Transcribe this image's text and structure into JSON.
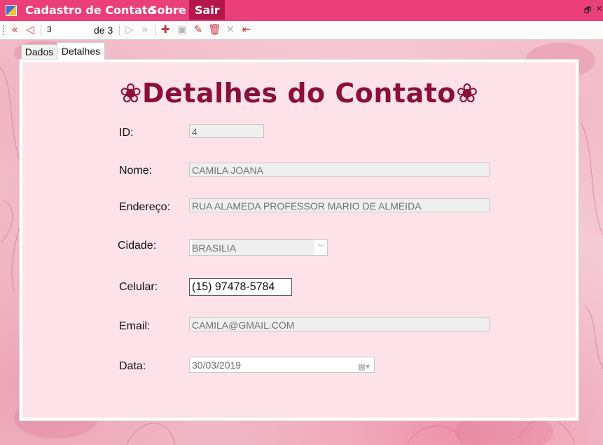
{
  "menu": {
    "items": [
      "Cadastro de Contato",
      "Sobre",
      "Sair"
    ]
  },
  "window": {
    "restore": "🗗",
    "close": "✕"
  },
  "toolbar": {
    "position": "3",
    "total": "de 3"
  },
  "tabs": [
    "Dados",
    "Detalhes"
  ],
  "form": {
    "title": "❀Detalhes do Contato❀",
    "id": {
      "label": "ID:",
      "value": "4"
    },
    "nome": {
      "label": "Nome:",
      "value": "CAMILA JOANA"
    },
    "endereco": {
      "label": "Endereço:",
      "value": "RUA ALAMEDA PROFESSOR MARIO DE ALMEIDA"
    },
    "cidade": {
      "label": "Cidade:",
      "value": "BRASILIA"
    },
    "celular": {
      "label": "Celular:",
      "value": "(15) 97478-5784"
    },
    "email": {
      "label": "Email:",
      "value": "CAMILA@GMAIL.COM"
    },
    "data": {
      "label": "Data:",
      "value": "30/03/2019"
    }
  },
  "colors": {
    "menubar": "#ea3f78",
    "active_menu": "#b5164a",
    "title": "#8a0f3a",
    "panel": "#fde2e9"
  },
  "icons": [
    "move-first-icon",
    "move-previous-icon",
    "move-next-icon",
    "move-last-icon",
    "add-icon",
    "save-icon",
    "edit-icon",
    "delete-icon",
    "cancel-icon",
    "exit-icon"
  ]
}
